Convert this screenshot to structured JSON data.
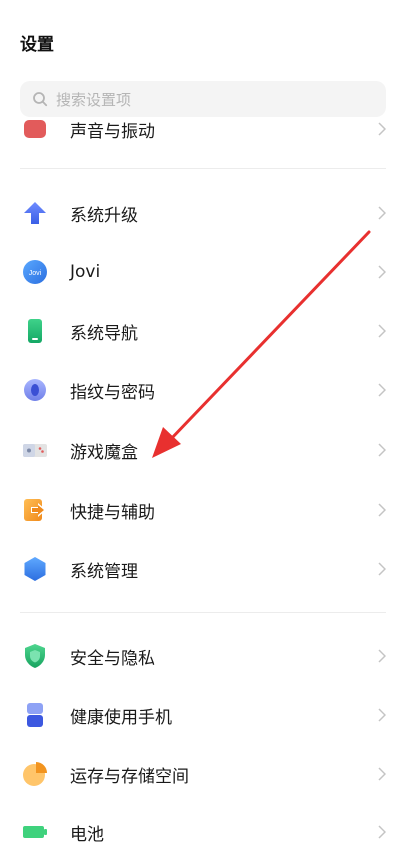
{
  "header": {
    "title": "设置"
  },
  "search": {
    "placeholder": "搜索设置项"
  },
  "partial_top_item": {
    "label": "声音与振动"
  },
  "groups": [
    {
      "items": [
        {
          "label": "系统升级"
        },
        {
          "label": "Jovi",
          "icon_text": "Jovi"
        },
        {
          "label": "系统导航"
        },
        {
          "label": "指纹与密码"
        },
        {
          "label": "游戏魔盒"
        },
        {
          "label": "快捷与辅助"
        },
        {
          "label": "系统管理"
        }
      ]
    },
    {
      "items": [
        {
          "label": "安全与隐私"
        },
        {
          "label": "健康使用手机"
        },
        {
          "label": "运存与存储空间"
        }
      ]
    }
  ],
  "partial_bottom_item": {
    "label": "电池"
  },
  "colors": {
    "annotation_arrow": "#e8302f",
    "chevron": "#c4c4c4"
  }
}
